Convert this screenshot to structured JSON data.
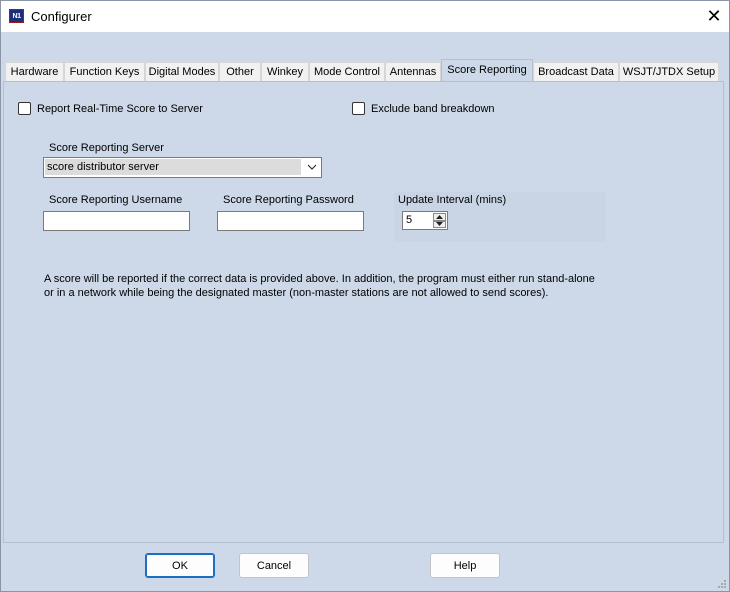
{
  "window": {
    "title": "Configurer",
    "icon_text": "N1",
    "close_glyph": "✕"
  },
  "tabs": [
    {
      "label": "Hardware",
      "active": false
    },
    {
      "label": "Function Keys",
      "active": false
    },
    {
      "label": "Digital Modes",
      "active": false
    },
    {
      "label": "Other",
      "active": false
    },
    {
      "label": "Winkey",
      "active": false
    },
    {
      "label": "Mode Control",
      "active": false
    },
    {
      "label": "Antennas",
      "active": false
    },
    {
      "label": "Score Reporting",
      "active": true
    },
    {
      "label": "Broadcast Data",
      "active": false
    },
    {
      "label": "WSJT/JTDX Setup",
      "active": false
    }
  ],
  "score_reporting": {
    "report_checkbox_label": "Report Real-Time Score to Server",
    "report_checked": false,
    "exclude_checkbox_label": "Exclude band breakdown",
    "exclude_checked": false,
    "server_label": "Score Reporting Server",
    "server_value": "score distributor server",
    "username_label": "Score Reporting Username",
    "username_value": "",
    "password_label": "Score Reporting Password",
    "password_value": "",
    "interval_label": "Update Interval (mins)",
    "interval_value": "5",
    "info_text": "A score will be reported if the correct data is provided above. In addition, the program must either run stand-alone or in a network while being the designated master (non-master stations are not allowed to send scores)."
  },
  "buttons": {
    "ok": "OK",
    "cancel": "Cancel",
    "help": "Help"
  }
}
